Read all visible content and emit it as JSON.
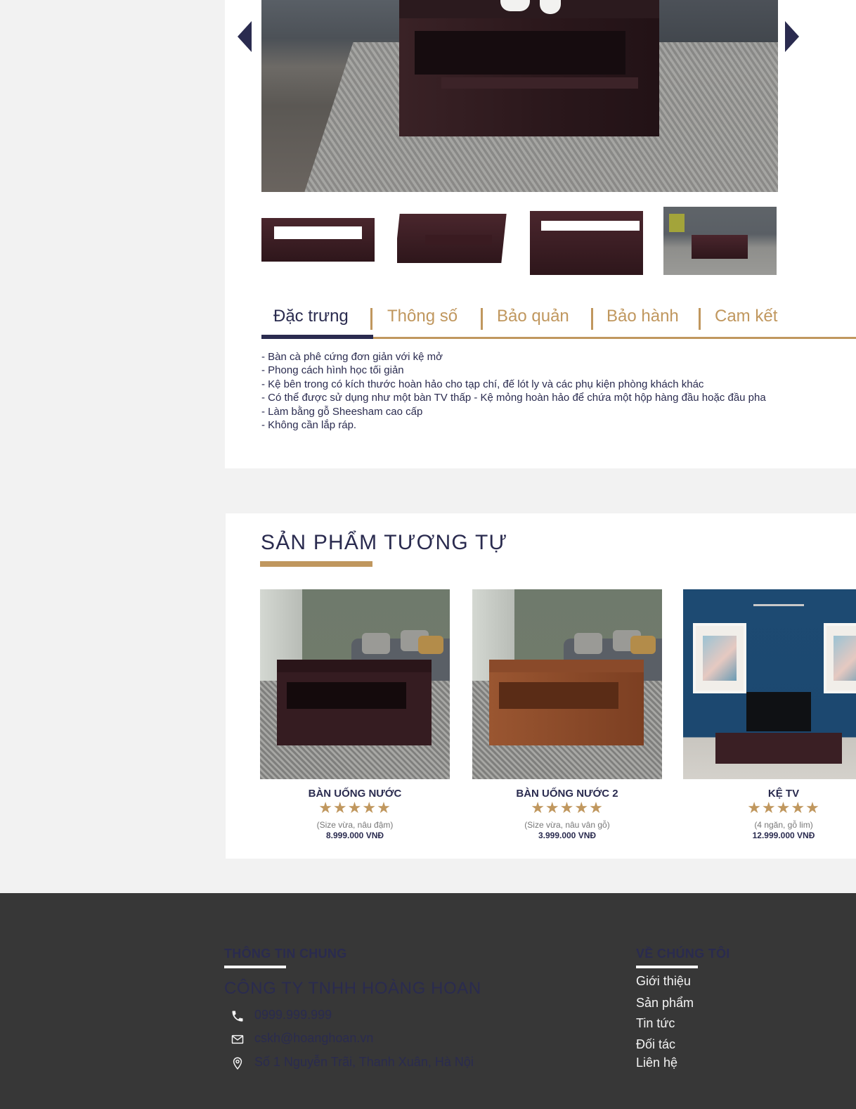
{
  "gallery": {
    "prev_icon": "chevron-left-icon",
    "next_icon": "chevron-right-icon"
  },
  "tabs": [
    {
      "label": "Đặc trưng"
    },
    {
      "label": "Thông số"
    },
    {
      "label": "Bảo quản"
    },
    {
      "label": "Bảo hành"
    },
    {
      "label": "Cam kết"
    }
  ],
  "active_tab": "Đặc trưng",
  "features": [
    "- Bàn cà phê cứng đơn giản với kệ mở",
    "- Phong cách hình học tối giản",
    "- Kệ bên trong có kích thước hoàn hảo cho tạp chí, đế lót ly và các phụ kiện phòng khách khác",
    "- Có thể được sử dụng như một bàn TV thấp - Kệ mỏng hoàn hảo để chứa một hộp hàng đầu hoặc đầu pha",
    "- Làm bằng gỗ Sheesham cao cấp",
    "- Không cần lắp ráp."
  ],
  "similar": {
    "title": "SẢN PHẨM TƯƠNG TỰ",
    "products": [
      {
        "name": "BÀN UỐNG NƯỚC",
        "stars": "★★★★★",
        "rating": 5,
        "variant": "(Size vừa, nâu đậm)",
        "price": "8.999.000 VNĐ"
      },
      {
        "name": "BÀN UỐNG NƯỚC 2",
        "stars": "★★★★★",
        "rating": 5,
        "variant": "(Size vừa, nâu vân gỗ)",
        "price": "3.999.000 VNĐ"
      },
      {
        "name": "KỆ TV",
        "stars": "★★★★★",
        "rating": 5,
        "variant": "(4 ngăn, gỗ lim)",
        "price": "12.999.000 VNĐ"
      }
    ]
  },
  "footer": {
    "general_heading": "THÔNG TIN CHUNG",
    "company": "CÔNG TY TNHH HOÀNG HOAN",
    "phone": "0999.999.999",
    "email": "cskh@hoanghoan.vn",
    "address": "Số 1 Nguyễn Trãi, Thanh Xuân, Hà Nội",
    "about_heading": "VỀ CHÚNG TÔI",
    "links": [
      "Giới thiệu",
      "Sản phẩm",
      "Tin tức",
      "Đối tác",
      "Liên hệ"
    ]
  },
  "colors": {
    "navy": "#2a2b4f",
    "gold": "#c0975e",
    "footer_bg": "#373737",
    "page_bg": "#f2f2f2"
  }
}
